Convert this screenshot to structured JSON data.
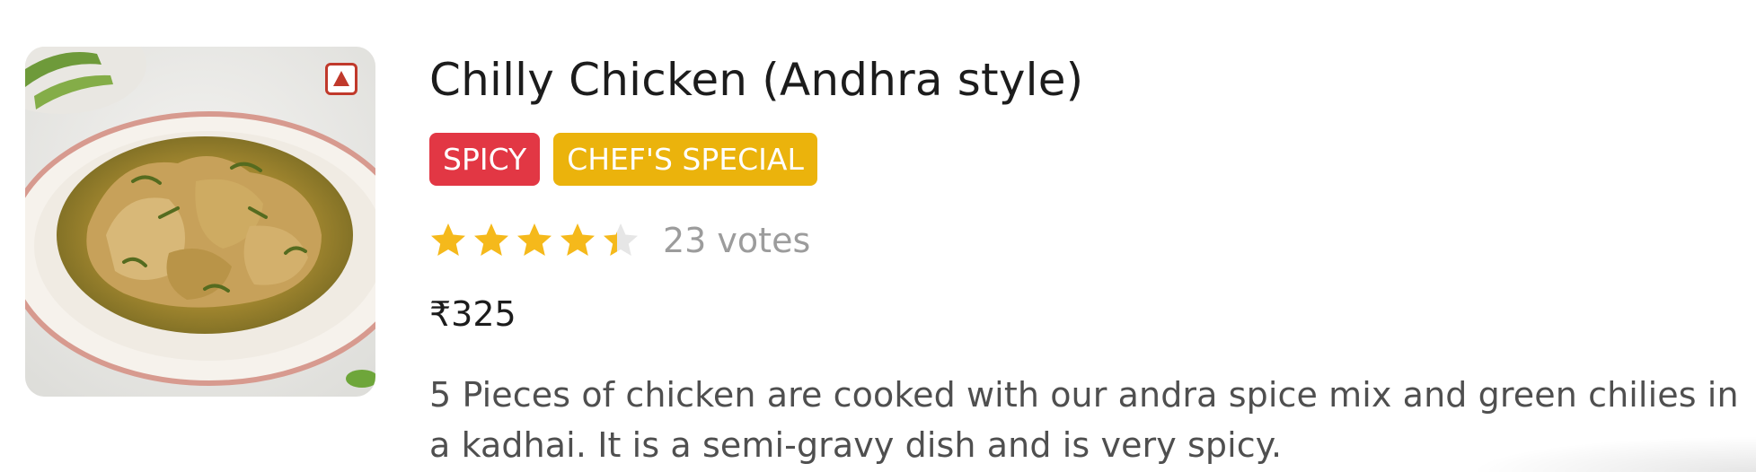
{
  "item": {
    "title": "Chilly Chicken (Andhra style)",
    "image_alt": "Chilly Chicken (Andhra style) dish",
    "tags": [
      {
        "label": "SPICY",
        "color": "#e23744"
      },
      {
        "label": "CHEF'S SPECIAL",
        "color": "#ebb30c"
      }
    ],
    "rating": {
      "stars": 4.4,
      "max_stars": 5,
      "votes_label": "23 votes"
    },
    "price": "₹325",
    "description": "5 Pieces of chicken are cooked with our andra spice mix and green chilies in a kadhai. It is a semi-gravy dish and is very spicy.",
    "food_type_icon": "non-veg-marker-icon"
  },
  "colors": {
    "star_filled": "#f5b91b",
    "star_empty": "#e6e6e6",
    "non_veg_marker": "#c0392b"
  }
}
